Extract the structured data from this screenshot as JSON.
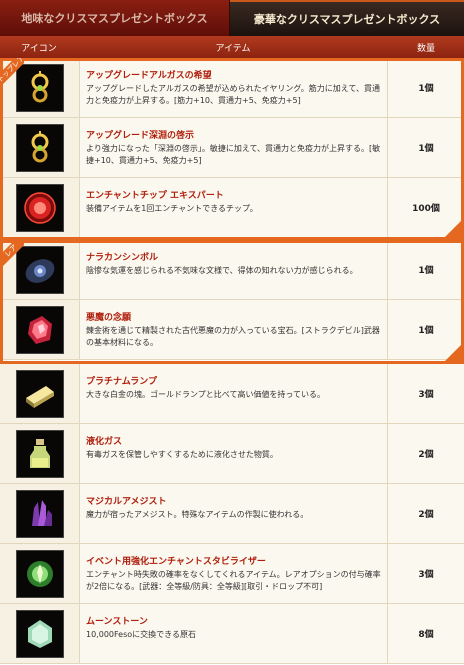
{
  "tabs": {
    "plain": "地味なクリスマスプレゼントボックス",
    "luxury": "豪華なクリスマスプレゼントボックス"
  },
  "header": {
    "icon": "アイコン",
    "item": "アイテム",
    "qty": "数量"
  },
  "ribbons": {
    "top": "トップレア",
    "rare": "レア"
  },
  "items": [
    {
      "name": "アップグレードアルガスの希望",
      "desc": "アップグレードしたアルガスの希望が込められたイヤリング。筋力に加えて、貫通力と免疫力が上昇する。[筋力+10、貫通力+5、免疫力+5]",
      "qty": "1個",
      "icon": "earring-icon"
    },
    {
      "name": "アップグレード深淵の啓示",
      "desc": "より強力になった「深淵の啓示」。敏捷に加えて、貫通力と免疫力が上昇する。[敏捷+10、貫通力+5、免疫力+5]",
      "qty": "1個",
      "icon": "earring-icon"
    },
    {
      "name": "エンチャントチップ エキスパート",
      "desc": "装備アイテムを1回エンチャントできるチップ。",
      "qty": "100個",
      "icon": "enchant-chip-icon"
    },
    {
      "name": "ナラカンシンボル",
      "desc": "陰惨な気運を感じられる不気味な文様で、得体の知れない力が感じられる。",
      "qty": "1個",
      "icon": "narakan-symbol-icon"
    },
    {
      "name": "悪魔の念願",
      "desc": "錬金術を通じて精製された古代悪魔の力が入っている宝石。[ストラクデビル]武器の基本材料になる。",
      "qty": "1個",
      "icon": "demon-gem-icon"
    },
    {
      "name": "プラチナムランプ",
      "desc": "大きな白金の塊。ゴールドランプと比べて高い価値を持っている。",
      "qty": "3個",
      "icon": "platinum-lump-icon"
    },
    {
      "name": "液化ガス",
      "desc": "有毒ガスを保管しやすくするために液化させた物質。",
      "qty": "2個",
      "icon": "liquid-gas-bottle-icon"
    },
    {
      "name": "マジカルアメジスト",
      "desc": "魔力が宿ったアメジスト。特殊なアイテムの作製に使われる。",
      "qty": "2個",
      "icon": "amethyst-icon"
    },
    {
      "name": "イベント用強化エンチャントスタビライザー",
      "desc": "エンチャント時失敗の確率をなくしてくれるアイテム。レアオプションの付与確率が2倍になる。[武器：全等級/防具：全等級][取引・ドロップ不可]",
      "qty": "3個",
      "icon": "stabilizer-icon"
    },
    {
      "name": "ムーンストーン",
      "desc": "10,000Fesoに交換できる原石",
      "qty": "8個",
      "icon": "moonstone-icon"
    }
  ]
}
